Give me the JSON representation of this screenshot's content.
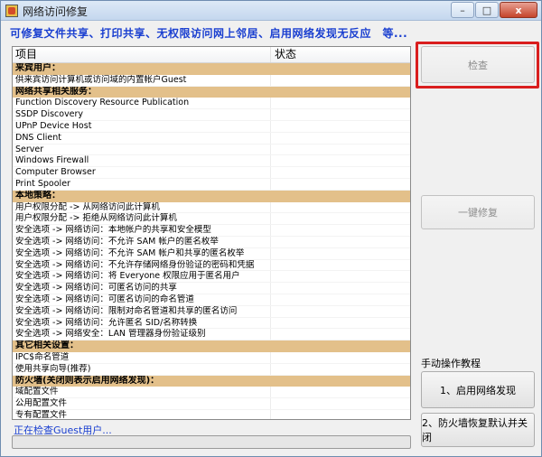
{
  "window": {
    "title": "网络访问修复"
  },
  "controls": {
    "minimize": "–",
    "maximize": "□",
    "close": "x"
  },
  "subtitle": "可修复文件共享、打印共享、无权限访问网上邻居、启用网络发现无反应　等...",
  "list": {
    "headers": [
      "项目",
      "状态"
    ],
    "rows": [
      {
        "type": "section",
        "label": "来宾用户："
      },
      {
        "type": "item",
        "label": "供来宾访问计算机或访问域的内置帐户Guest",
        "status": ""
      },
      {
        "type": "section",
        "label": "网络共享相关服务："
      },
      {
        "type": "item",
        "label": "Function Discovery Resource Publication",
        "status": ""
      },
      {
        "type": "item",
        "label": "SSDP Discovery",
        "status": ""
      },
      {
        "type": "item",
        "label": "UPnP Device Host",
        "status": ""
      },
      {
        "type": "item",
        "label": "DNS Client",
        "status": ""
      },
      {
        "type": "item",
        "label": "Server",
        "status": ""
      },
      {
        "type": "item",
        "label": "Windows Firewall",
        "status": ""
      },
      {
        "type": "item",
        "label": "Computer Browser",
        "status": ""
      },
      {
        "type": "item",
        "label": "Print Spooler",
        "status": ""
      },
      {
        "type": "section",
        "label": "本地策略："
      },
      {
        "type": "item",
        "label": "用户权限分配 -> 从网络访问此计算机",
        "status": ""
      },
      {
        "type": "item",
        "label": "用户权限分配 -> 拒绝从网络访问此计算机",
        "status": ""
      },
      {
        "type": "item",
        "label": "安全选项 -> 网络访问：本地帐户的共享和安全模型",
        "status": ""
      },
      {
        "type": "item",
        "label": "安全选项 -> 网络访问：不允许 SAM 帐户的匿名枚举",
        "status": ""
      },
      {
        "type": "item",
        "label": "安全选项 -> 网络访问：不允许 SAM 帐户和共享的匿名枚举",
        "status": ""
      },
      {
        "type": "item",
        "label": "安全选项 -> 网络访问：不允许存储网络身份验证的密码和凭据",
        "status": ""
      },
      {
        "type": "item",
        "label": "安全选项 -> 网络访问：将 Everyone 权限应用于匿名用户",
        "status": ""
      },
      {
        "type": "item",
        "label": "安全选项 -> 网络访问：可匿名访问的共享",
        "status": ""
      },
      {
        "type": "item",
        "label": "安全选项 -> 网络访问：可匿名访问的命名管道",
        "status": ""
      },
      {
        "type": "item",
        "label": "安全选项 -> 网络访问：限制对命名管道和共享的匿名访问",
        "status": ""
      },
      {
        "type": "item",
        "label": "安全选项 -> 网络访问：允许匿名 SID/名称转换",
        "status": ""
      },
      {
        "type": "item",
        "label": "安全选项 -> 网络安全：LAN 管理器身份验证级别",
        "status": ""
      },
      {
        "type": "section",
        "label": "其它相关设置："
      },
      {
        "type": "item",
        "label": "IPC$命名管道",
        "status": ""
      },
      {
        "type": "item",
        "label": "使用共享向导(推荐)",
        "status": ""
      },
      {
        "type": "section",
        "label": "防火墙(关闭则表示启用网络发现)："
      },
      {
        "type": "item",
        "label": "域配置文件",
        "status": ""
      },
      {
        "type": "item",
        "label": "公用配置文件",
        "status": ""
      },
      {
        "type": "item",
        "label": "专有配置文件",
        "status": ""
      }
    ]
  },
  "status_text": "正在检查Guest用户...",
  "progress": {
    "percent": 0,
    "fill_color": "#3bb44a"
  },
  "buttons": {
    "check": "检查",
    "repair_all": "一键修复",
    "manual_label": "手动操作教程",
    "enable_discovery": "1、启用网络发现",
    "restore_firewall": "2、防火墙恢复默认并关闭"
  },
  "colors": {
    "section_bg": "#e3c08a",
    "accent_text": "#1a3fd0",
    "highlight": "#d91e1e"
  }
}
